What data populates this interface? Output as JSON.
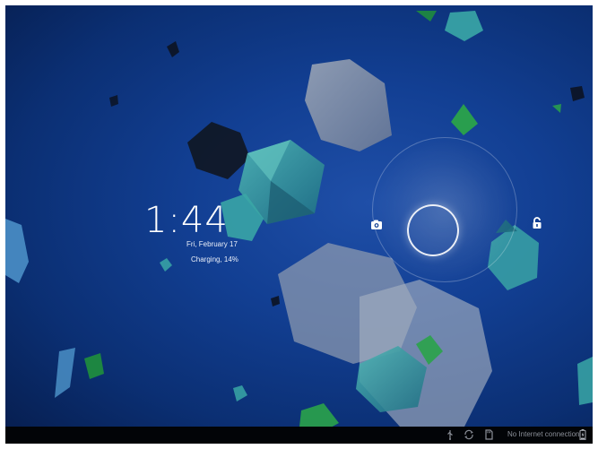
{
  "lockscreen": {
    "time": "1:44",
    "date": "Fri, February 17",
    "charging_status": "Charging, 14%"
  },
  "status_bar": {
    "network_status": "No Internet connection",
    "icons": [
      "usb-icon",
      "sync-icon",
      "sdcard-icon",
      "battery-icon"
    ]
  },
  "targets": {
    "left": "camera-icon",
    "right": "unlock-icon"
  },
  "colors": {
    "background_blue": "#123f93",
    "taskbar": "#020407",
    "gem_teal": "#3aa7a6",
    "gem_green": "#1f8b3e"
  }
}
